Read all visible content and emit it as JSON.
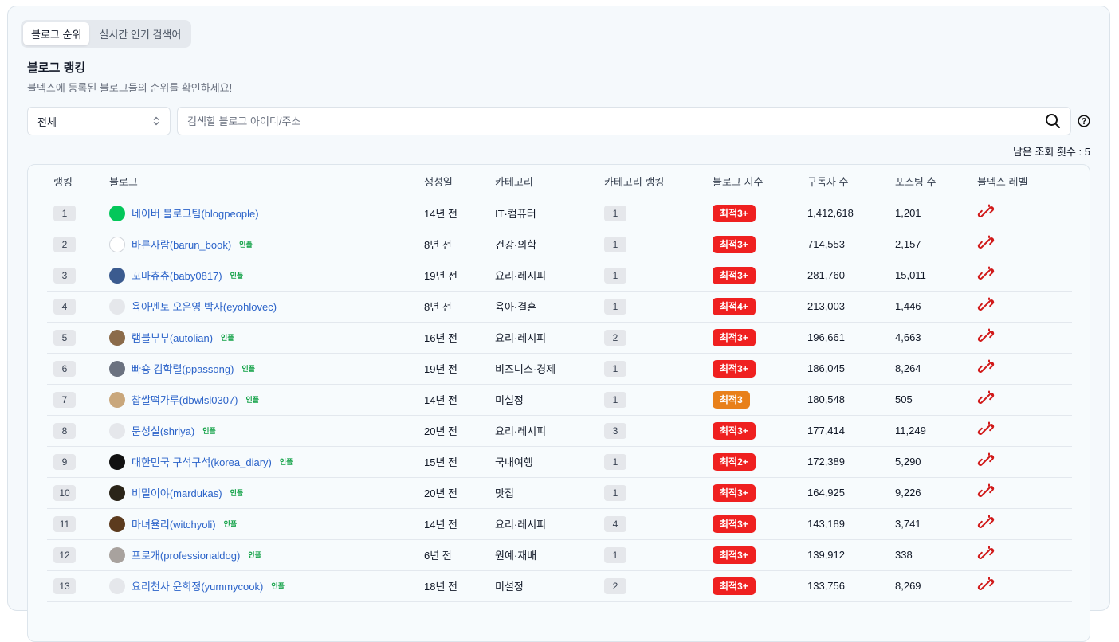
{
  "tabs": [
    {
      "label": "블로그 순위",
      "active": true
    },
    {
      "label": "실시간 인기 검색어",
      "active": false
    }
  ],
  "header": {
    "title": "블로그 랭킹",
    "subtitle": "블덱스에 등록된 블로그들의 순위를 확인하세요!"
  },
  "filter": {
    "selected": "전체"
  },
  "search": {
    "placeholder": "검색할 블로그 아이디/주소",
    "value": ""
  },
  "remaining": "남은 조회 횟수 : 5",
  "columns": [
    "랭킹",
    "블로그",
    "생성일",
    "카테고리",
    "카테고리 랭킹",
    "블로그 지수",
    "구독자 수",
    "포스팅 수",
    "블덱스 레벨"
  ],
  "colors": {
    "score_red": "#ef2020",
    "score_orange": "#e8801a",
    "link": "#2b63c9",
    "influencer": "#16a34a"
  },
  "rows": [
    {
      "rank": "1",
      "blog": "네이버 블로그팀(blogpeople)",
      "influencer": "",
      "created": "14년 전",
      "category": "IT·컴퓨터",
      "cat_rank": "1",
      "score": "최적3+",
      "score_color": "red",
      "subscribers": "1,412,618",
      "posts": "1,201",
      "avatar": "naver-blog-logo"
    },
    {
      "rank": "2",
      "blog": "바른사람(barun_book)",
      "influencer": "인플",
      "created": "8년 전",
      "category": "건강·의학",
      "cat_rank": "1",
      "score": "최적3+",
      "score_color": "red",
      "subscribers": "714,553",
      "posts": "2,157",
      "avatar": "text-logo"
    },
    {
      "rank": "3",
      "blog": "꼬마츄츄(baby0817)",
      "influencer": "인플",
      "created": "19년 전",
      "category": "요리·레시피",
      "cat_rank": "1",
      "score": "최적3+",
      "score_color": "red",
      "subscribers": "281,760",
      "posts": "15,011",
      "avatar": "character"
    },
    {
      "rank": "4",
      "blog": "육아멘토 오은영 박사(eyohlovec)",
      "influencer": "",
      "created": "8년 전",
      "category": "육아·결혼",
      "cat_rank": "1",
      "score": "최적4+",
      "score_color": "red",
      "subscribers": "213,003",
      "posts": "1,446",
      "avatar": "portrait"
    },
    {
      "rank": "5",
      "blog": "램블부부(autolian)",
      "influencer": "인플",
      "created": "16년 전",
      "category": "요리·레시피",
      "cat_rank": "2",
      "score": "최적3+",
      "score_color": "red",
      "subscribers": "196,661",
      "posts": "4,663",
      "avatar": "couple"
    },
    {
      "rank": "6",
      "blog": "빠숑 김학렬(ppassong)",
      "influencer": "인플",
      "created": "19년 전",
      "category": "비즈니스·경제",
      "cat_rank": "1",
      "score": "최적3+",
      "score_color": "red",
      "subscribers": "186,045",
      "posts": "8,264",
      "avatar": "person"
    },
    {
      "rank": "7",
      "blog": "찹쌀떡가루(dbwlsl0307)",
      "influencer": "인플",
      "created": "14년 전",
      "category": "미설정",
      "cat_rank": "1",
      "score": "최적3",
      "score_color": "orange",
      "subscribers": "180,548",
      "posts": "505",
      "avatar": "pattern"
    },
    {
      "rank": "8",
      "blog": "문성실(shriya)",
      "influencer": "인플",
      "created": "20년 전",
      "category": "요리·레시피",
      "cat_rank": "3",
      "score": "최적3+",
      "score_color": "red",
      "subscribers": "177,414",
      "posts": "11,249",
      "avatar": "portrait"
    },
    {
      "rank": "9",
      "blog": "대한민국 구석구석(korea_diary)",
      "influencer": "인플",
      "created": "15년 전",
      "category": "국내여행",
      "cat_rank": "1",
      "score": "최적2+",
      "score_color": "red",
      "subscribers": "172,389",
      "posts": "5,290",
      "avatar": "dark-logo"
    },
    {
      "rank": "10",
      "blog": "비밀이야(mardukas)",
      "influencer": "인플",
      "created": "20년 전",
      "category": "맛집",
      "cat_rank": "1",
      "score": "최적3+",
      "score_color": "red",
      "subscribers": "164,925",
      "posts": "9,226",
      "avatar": "dark-photo"
    },
    {
      "rank": "11",
      "blog": "마녀율리(witchyoli)",
      "influencer": "인플",
      "created": "14년 전",
      "category": "요리·레시피",
      "cat_rank": "4",
      "score": "최적3+",
      "score_color": "red",
      "subscribers": "143,189",
      "posts": "3,741",
      "avatar": "food"
    },
    {
      "rank": "12",
      "blog": "프로개(professionaldog)",
      "influencer": "인플",
      "created": "6년 전",
      "category": "원예·재배",
      "cat_rank": "1",
      "score": "최적3+",
      "score_color": "red",
      "subscribers": "139,912",
      "posts": "338",
      "avatar": "dog"
    },
    {
      "rank": "13",
      "blog": "요리천사 윤희정(yummycook)",
      "influencer": "인플",
      "created": "18년 전",
      "category": "미설정",
      "cat_rank": "2",
      "score": "최적3+",
      "score_color": "red",
      "subscribers": "133,756",
      "posts": "8,269",
      "avatar": "portrait"
    }
  ]
}
